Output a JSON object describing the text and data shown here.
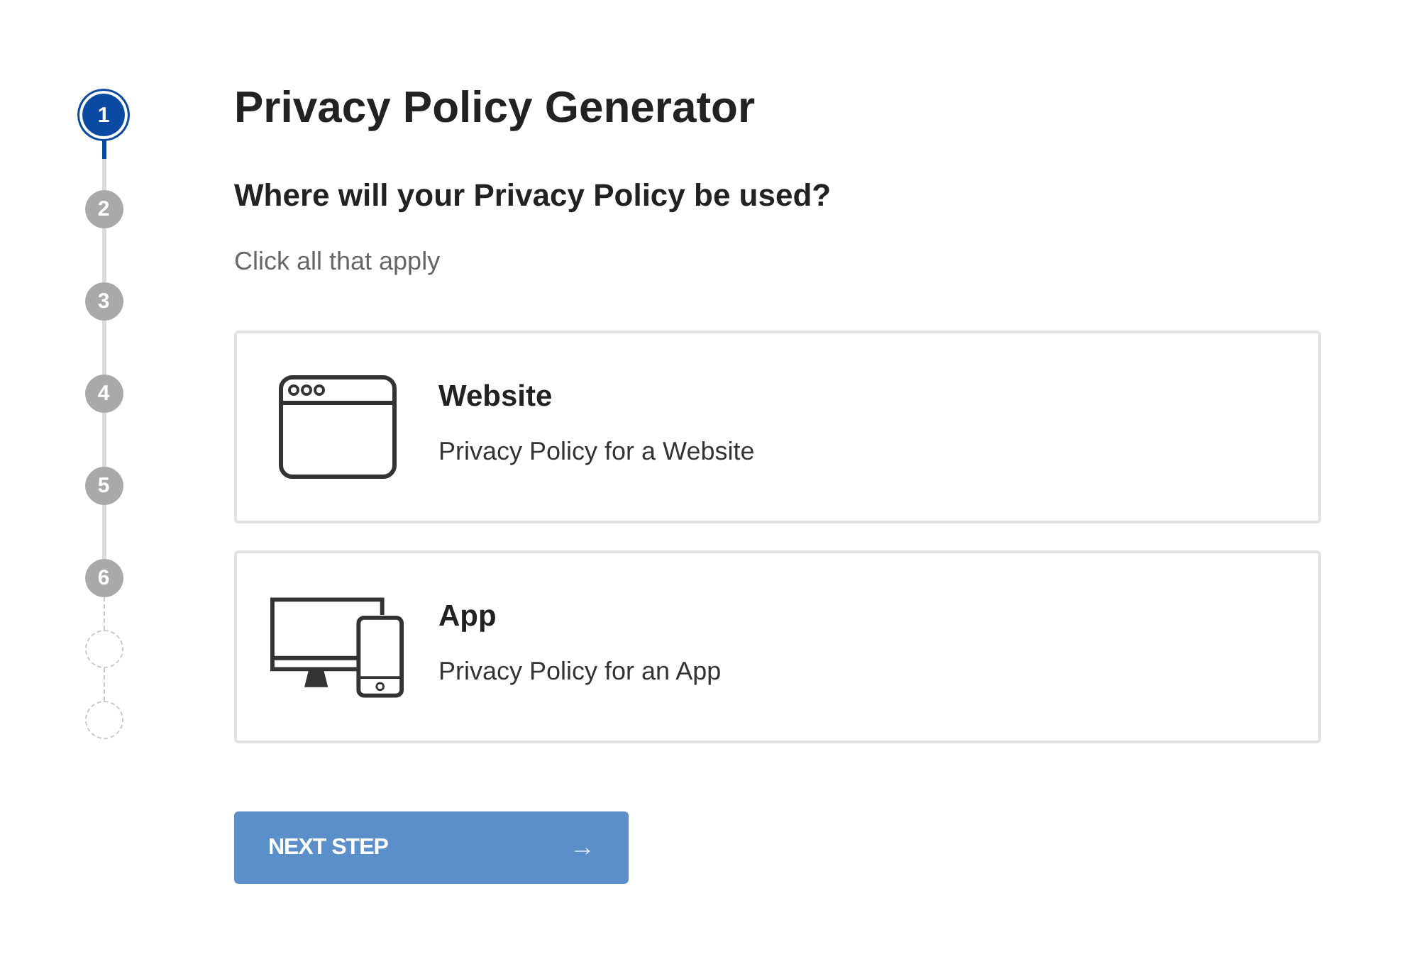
{
  "steps": [
    {
      "kind": "number",
      "label": "1",
      "selected": true
    },
    {
      "kind": "number",
      "label": "2",
      "selected": false
    },
    {
      "kind": "number",
      "label": "3",
      "selected": false
    },
    {
      "kind": "number",
      "label": "4",
      "selected": false
    },
    {
      "kind": "number",
      "label": "5",
      "selected": false
    },
    {
      "kind": "number",
      "label": "6",
      "selected": false
    },
    {
      "kind": "empty",
      "selected": false
    },
    {
      "kind": "empty",
      "selected": false
    }
  ],
  "title": "Privacy Policy Generator",
  "question": "Where will your Privacy Policy be used?",
  "hint": "Click all that apply",
  "options": [
    {
      "kind": "website",
      "title": "Website",
      "description": "Privacy Policy for a Website",
      "selected": false
    },
    {
      "kind": "app",
      "title": "App",
      "description": "Privacy Policy for an App",
      "selected": false
    }
  ],
  "next_button": {
    "label": "NEXT STEP",
    "arrow": "→",
    "disabled": true
  }
}
